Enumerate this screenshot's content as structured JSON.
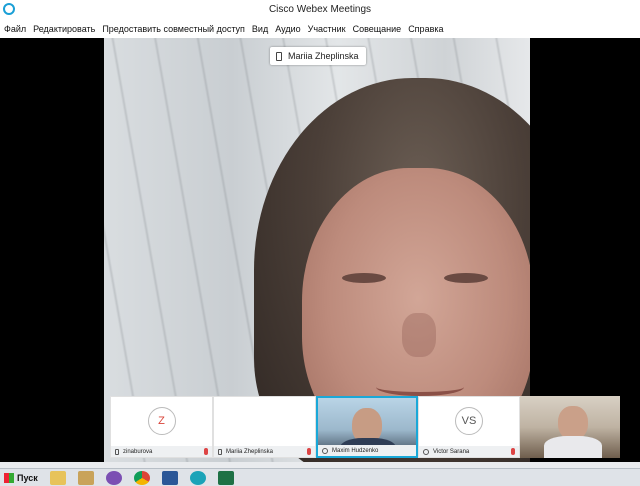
{
  "window": {
    "title": "Cisco Webex Meetings"
  },
  "menu": [
    "Файл",
    "Редактировать",
    "Предоставить совместный доступ",
    "Вид",
    "Аудио",
    "Участник",
    "Совещание",
    "Справка"
  ],
  "main_video": {
    "name": "Mariia Zheplinska"
  },
  "participants": [
    {
      "name": "zinaburova",
      "avatar": "Z"
    },
    {
      "name": "Mariia Zheplinska"
    },
    {
      "name": "Maxim Hudzenko"
    },
    {
      "name": "Victor Sarana",
      "avatar": "VS"
    }
  ],
  "taskbar": {
    "start_label": "Пуск"
  }
}
